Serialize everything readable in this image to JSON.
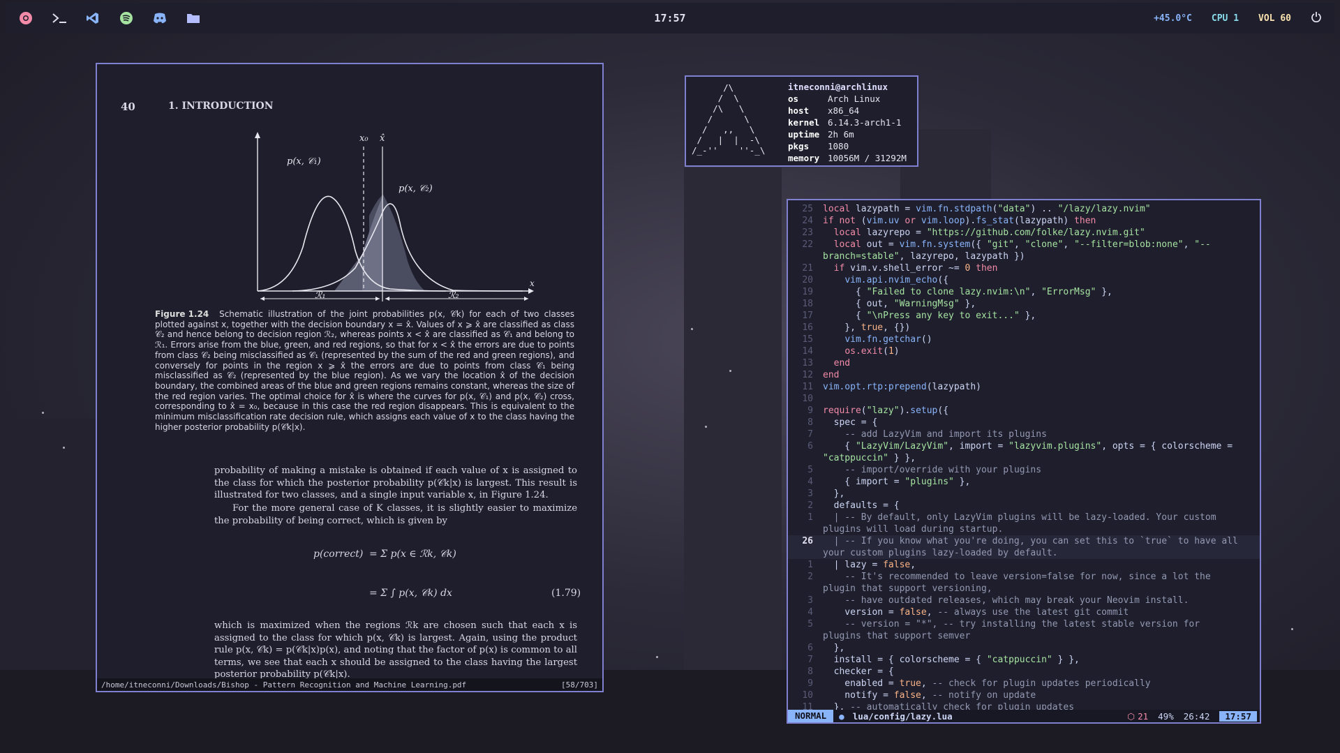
{
  "topbar": {
    "clock": "17:57",
    "temperature": "+45.0°C",
    "cpu": "CPU 1",
    "volume": "VOL 60",
    "icons": [
      "chromium-icon",
      "terminal-icon",
      "vscode-icon",
      "spotify-icon",
      "discord-icon",
      "folder-icon",
      "power-icon"
    ]
  },
  "pdf": {
    "page_number": "40",
    "chapter": "1. INTRODUCTION",
    "figure": {
      "label_x0": "x₀",
      "label_xhat": "x̂",
      "label_pc1": "p(x, 𝒞₁)",
      "label_pc2": "p(x, 𝒞₂)",
      "label_x": "x",
      "label_r1": "ℛ₁",
      "label_r2": "ℛ₂"
    },
    "caption_label": "Figure 1.24",
    "caption_text": "Schematic illustration of the joint probabilities p(x, 𝒞k) for each of two classes plotted against x, together with the decision boundary x = x̂. Values of x ⩾ x̂ are classified as class 𝒞₂ and hence belong to decision region ℛ₂, whereas points x < x̂ are classified as 𝒞₁ and belong to ℛ₁. Errors arise from the blue, green, and red regions, so that for x < x̂ the errors are due to points from class 𝒞₂ being misclassified as 𝒞₁ (represented by the sum of the red and green regions), and conversely for points in the region x ⩾ x̂ the errors are due to points from class 𝒞₁ being misclassified as 𝒞₂ (represented by the blue region). As we vary the location x̂ of the decision boundary, the combined areas of the blue and green regions remains constant, whereas the size of the red region varies. The optimal choice for x̂ is where the curves for p(x, 𝒞₁) and p(x, 𝒞₂) cross, corresponding to x̂ = x₀, because in this case the red region disappears. This is equivalent to the minimum misclassification rate decision rule, which assigns each value of x to the class having the higher posterior probability p(𝒞k|x).",
    "para1": "probability of making a mistake is obtained if each value of x is assigned to the class for which the posterior probability p(𝒞k|x) is largest. This result is illustrated for two classes, and a single input variable x, in Figure 1.24.",
    "para2": "For the more general case of K classes, it is slightly easier to maximize the probability of being correct, which is given by",
    "eq_lhs": "p(correct)",
    "eq_line1": "=  Σ p(x ∈ ℛk, 𝒞k)",
    "eq_line2": "=  Σ ∫ p(x, 𝒞k) dx",
    "eq_number": "(1.79)",
    "para3": "which is maximized when the regions ℛk are chosen such that each x is assigned to the class for which p(x, 𝒞k) is largest. Again, using the product rule p(x, 𝒞k) = p(𝒞k|x)p(x), and noting that the factor of p(x) is common to all terms, we see that each x should be assigned to the class having the largest posterior probability p(𝒞k|x).",
    "status_path": "/home/itneconni/Downloads/Bishop - Pattern Recognition and Machine Learning.pdf",
    "status_page": "[58/703]"
  },
  "fetch": {
    "user": "itneconni@archlinux",
    "logo": "      /\\\n     /  \\\n    /\\   \\\n   /      \\\n  /   ,,   \\\n /   |  |  -\\\n/_-''    ''-_\\",
    "rows": [
      {
        "k": "os",
        "v": "Arch Linux"
      },
      {
        "k": "host",
        "v": "x86_64"
      },
      {
        "k": "kernel",
        "v": "6.14.3-arch1-1"
      },
      {
        "k": "uptime",
        "v": "2h 6m"
      },
      {
        "k": "pkgs",
        "v": "1080"
      },
      {
        "k": "memory",
        "v": "10056M / 31292M"
      }
    ]
  },
  "nvim": {
    "mode": "NORMAL",
    "file": "lua/config/lazy.lua",
    "warnings": "21",
    "percent": "49%",
    "position": "26:42",
    "time": "17:57"
  }
}
